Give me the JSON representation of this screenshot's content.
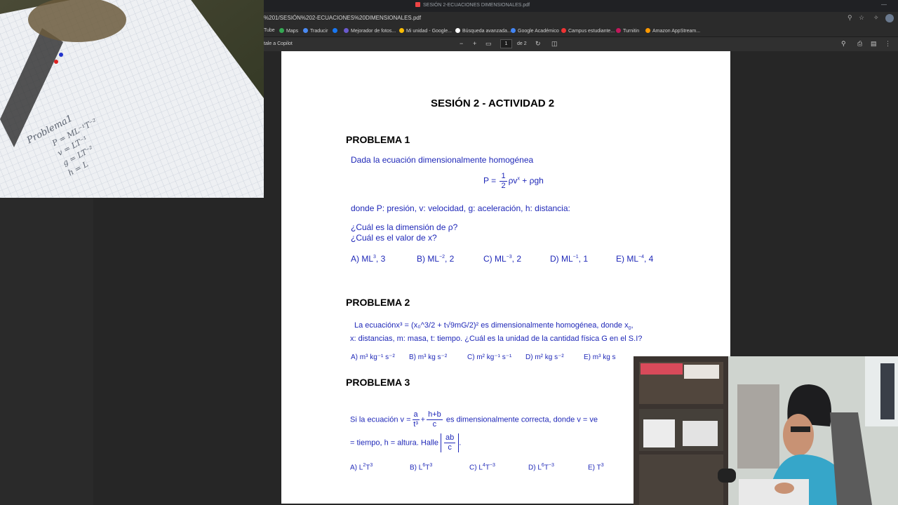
{
  "browser": {
    "tab_title": "SESIÓN 2-ECUACIONES DIMENSIONALES.pdf",
    "url": "%201/SESIÓN%202-ECUACIONES%20DIMENSIONALES.pdf",
    "bookmarks": [
      {
        "label": "Tube",
        "color": "#e33"
      },
      {
        "label": "Maps",
        "color": "#34a853"
      },
      {
        "label": "Traducir",
        "color": "#4a8af4"
      },
      {
        "label": "",
        "color": "#1877f2"
      },
      {
        "label": "Mejorador de fotos...",
        "color": "#6a5acd"
      },
      {
        "label": "Mi unidad - Google...",
        "color": "#fbbc04"
      },
      {
        "label": "Búsqueda avanzada...",
        "color": "#ffffff"
      },
      {
        "label": "Google Académico",
        "color": "#4285f4"
      },
      {
        "label": "Campus estudiante...",
        "color": "#e33"
      },
      {
        "label": "Turnitin",
        "color": "#c2185b"
      },
      {
        "label": "Amazon AppStream...",
        "color": "#ff9900"
      }
    ]
  },
  "pdf_toolbar": {
    "copilot": "tale a Copilot",
    "page_current": "1",
    "page_total": "de 2"
  },
  "pdf": {
    "title": "SESIÓN 2 - ACTIVIDAD 2",
    "p1": {
      "heading": "PROBLEMA 1",
      "intro": "Dada la ecuación dimensionalmente homogénea",
      "eq_left": "P =",
      "eq_num": "1",
      "eq_den": "2",
      "eq_rest": "ρv",
      "eq_exp": "x",
      "eq_tail": " + ρgh",
      "where": "donde P: presión, v: velocidad, g: aceleración, h: distancia:",
      "q1": "¿Cuál es la dimensión de ρ?",
      "q2": "¿Cuál es el valor de x?",
      "options": [
        {
          "pre": "A) ML",
          "exp": "3",
          "post": ", 3"
        },
        {
          "pre": "B) ML",
          "exp": "−2",
          "post": ", 2"
        },
        {
          "pre": "C) ML",
          "exp": "−3",
          "post": ", 2"
        },
        {
          "pre": "D) ML",
          "exp": "−1",
          "post": ", 1"
        },
        {
          "pre": "E) ML",
          "exp": "−4",
          "post": ", 4"
        }
      ]
    },
    "p2": {
      "heading": "PROBLEMA 2",
      "line1_a": "La ecuación",
      "line1_eq": "x³ = (x₀^3/2 + t√9mG/2)²",
      "line1_b": " es dimensionalmente homogénea,  donde  x",
      "line1_sub": "0",
      "line1_c": ",",
      "line2": "x: distancias, m: masa, t: tiempo. ¿Cuál es la unidad de la cantidad física G en el S.I?",
      "options": [
        "A) m³ kg⁻¹ s⁻²",
        "B) m³ kg s⁻²",
        "C) m² kg⁻¹ s⁻¹",
        "D) m² kg s⁻²",
        "E) m³ kg s"
      ]
    },
    "p3": {
      "heading": "PROBLEMA 3",
      "line1_a": "Si la ecuación   v =",
      "f1_n": "a",
      "f1_d": "t³",
      "plus": "+",
      "f2_n": "h+b",
      "f2_d": "c",
      "line1_b": " es dimensionalmente correcta, donde  v =  ve",
      "line2_a": "= tiempo, h = altura. Halle",
      "f3_n": "ab",
      "f3_d": "c",
      "line2_b": ".",
      "options": [
        {
          "pre": "A) L",
          "exp": "2",
          "mid": "T",
          "exp2": "3"
        },
        {
          "pre": "B) L",
          "exp": "6",
          "mid": "T",
          "exp2": "3"
        },
        {
          "pre": "C) L",
          "exp": "4",
          "mid": "T",
          "exp2": "−3"
        },
        {
          "pre": "D) L",
          "exp": "6",
          "mid": "T",
          "exp2": "−3"
        },
        {
          "pre": "E) T",
          "exp": "3",
          "mid": "",
          "exp2": ""
        }
      ]
    }
  },
  "notes": {
    "line1": "Problema1",
    "line2": "P = ML⁻¹T⁻²",
    "line3": "v = LT⁻¹",
    "line4": "g = LT⁻²",
    "line5": "h = L"
  }
}
